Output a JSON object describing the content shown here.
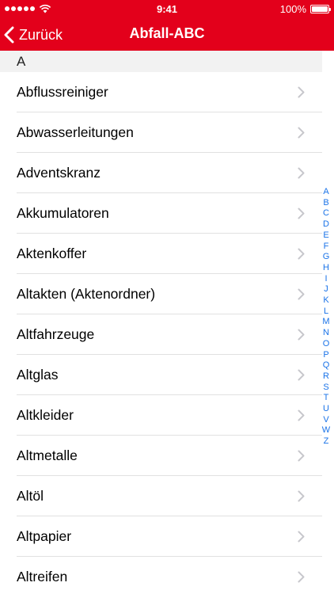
{
  "status_bar": {
    "time": "9:41",
    "battery": "100%"
  },
  "nav": {
    "back_label": "Zurück",
    "title": "Abfall-ABC"
  },
  "section": "A",
  "items": [
    "Abflussreiniger",
    "Abwasserleitungen",
    "Adventskranz",
    "Akkumulatoren",
    "Aktenkoffer",
    "Altakten (Aktenordner)",
    "Altfahrzeuge",
    "Altglas",
    "Altkleider",
    "Altmetalle",
    "Altöl",
    "Altpapier",
    "Altreifen"
  ],
  "index_letters": [
    "A",
    "B",
    "C",
    "D",
    "E",
    "F",
    "G",
    "H",
    "I",
    "J",
    "K",
    "L",
    "M",
    "N",
    "O",
    "P",
    "Q",
    "R",
    "S",
    "T",
    "U",
    "V",
    "W",
    "Z"
  ],
  "colors": {
    "brand": "#e3001b",
    "index": "#1a73e8",
    "header_bg": "#f2f2f2"
  },
  "icons": {
    "back": "chevron-left-icon",
    "row": "chevron-right-icon",
    "wifi": "wifi-icon",
    "battery": "battery-icon",
    "signal": "signal-dots-icon"
  }
}
